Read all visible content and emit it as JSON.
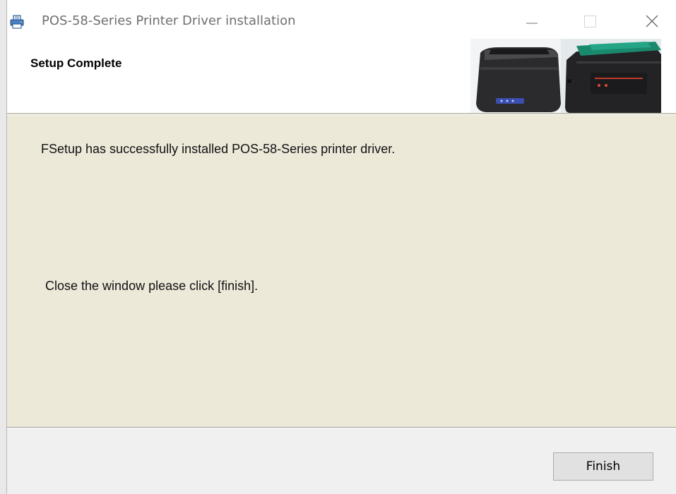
{
  "window": {
    "title": "POS-58-Series Printer Driver installation",
    "app_icon": "printer-icon",
    "controls": [
      "minimize-icon",
      "maximize-icon",
      "close-icon"
    ]
  },
  "header": {
    "title": "Setup Complete",
    "banner_image": "thermal-printers-image"
  },
  "content": {
    "message_success": "FSetup has successfully installed POS-58-Series printer driver.",
    "message_instruction": "Close the window please click [finish]."
  },
  "footer": {
    "finish_label": "Finish"
  },
  "colors": {
    "content_background": "#ece9d9",
    "footer_background": "#f0f0f0",
    "title_text": "#6f6f6f"
  }
}
